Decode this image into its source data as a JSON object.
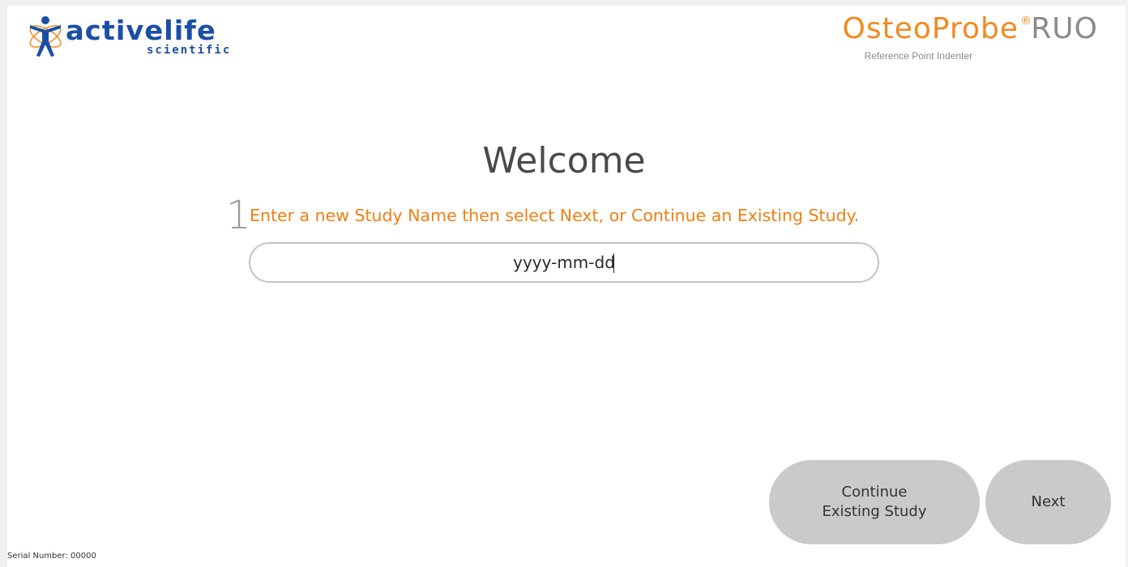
{
  "header": {
    "left_logo": {
      "wordmark": "activelife",
      "subword": "scientific",
      "icon": "figure-atom-icon",
      "color": "#1a4fa8"
    },
    "right_logo": {
      "product": "OsteoProbe",
      "registered": "®",
      "suffix": "RUO",
      "tagline": "Reference Point Indenter",
      "product_color": "#f28a1e",
      "suffix_color": "#8a8a8a"
    }
  },
  "main": {
    "title": "Welcome",
    "step_number": "1",
    "instruction": "Enter a new Study Name then select Next, or Continue an Existing Study.",
    "study_name_input": {
      "value": "yyyy-mm-dd",
      "placeholder": ""
    }
  },
  "actions": {
    "continue_label": "Continue\nExisting Study",
    "next_label": "Next",
    "button_color": "#cbcac8"
  },
  "footer": {
    "serial_label": "Serial Number: 00000"
  }
}
